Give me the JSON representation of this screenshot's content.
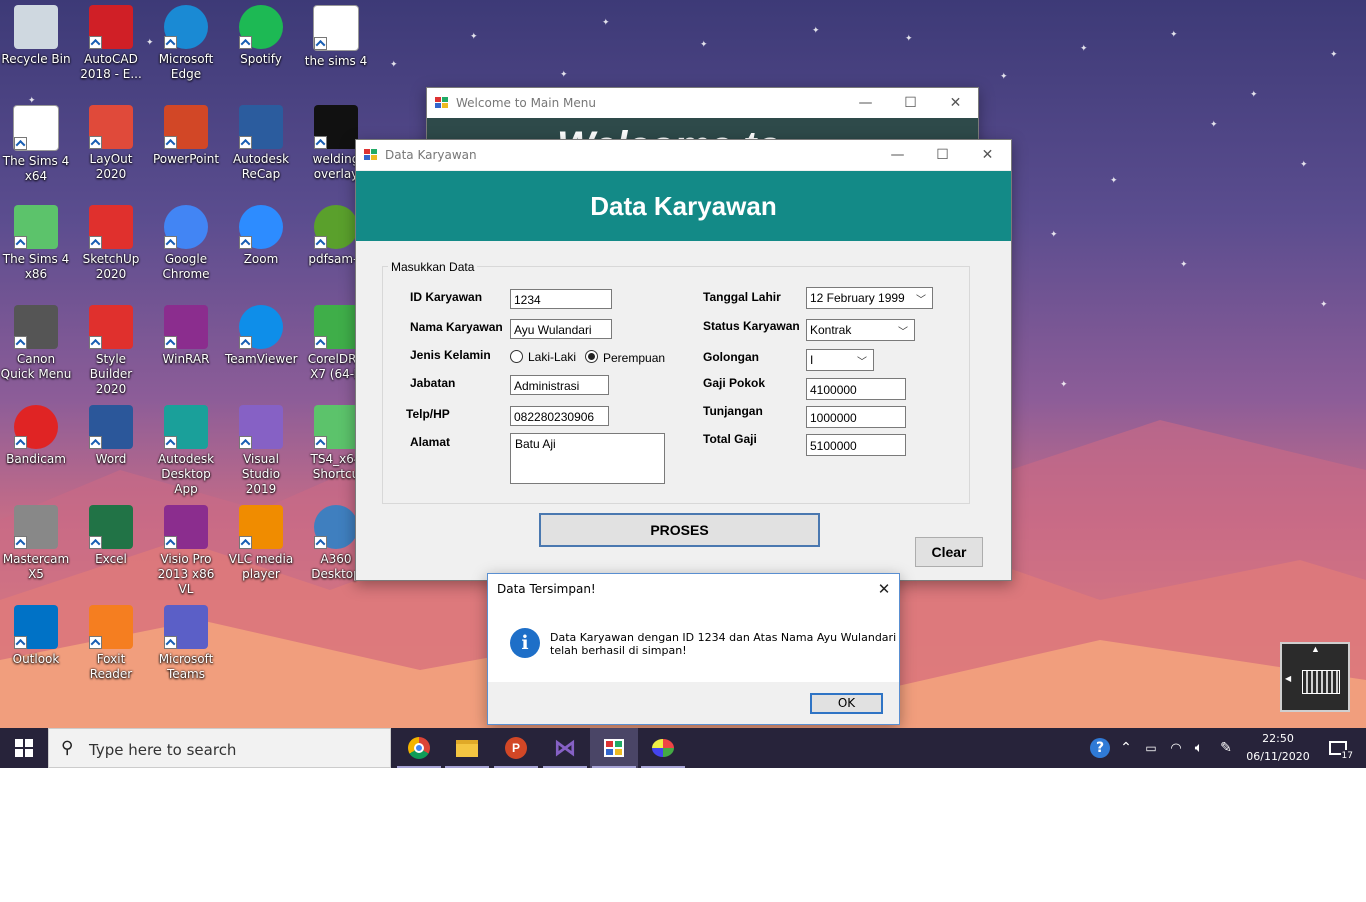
{
  "desktop": {
    "icons": [
      {
        "label": "Recycle Bin",
        "icon": "recycle-bin-icon"
      },
      {
        "label": "AutoCAD 2018 - E...",
        "icon": "autocad-icon"
      },
      {
        "label": "Microsoft Edge",
        "icon": "edge-icon"
      },
      {
        "label": "Spotify",
        "icon": "spotify-icon"
      },
      {
        "label": "the sims 4",
        "icon": "text-file-icon"
      },
      {
        "label": "The Sims 4 x64",
        "icon": "file-icon"
      },
      {
        "label": "LayOut 2020",
        "icon": "layout-icon"
      },
      {
        "label": "PowerPoint",
        "icon": "powerpoint-icon"
      },
      {
        "label": "Autodesk ReCap",
        "icon": "recap-icon"
      },
      {
        "label": "welding overlay",
        "icon": "welding-icon"
      },
      {
        "label": "The Sims 4 x86",
        "icon": "sims-icon"
      },
      {
        "label": "SketchUp 2020",
        "icon": "sketchup-icon"
      },
      {
        "label": "Google Chrome",
        "icon": "chrome-icon"
      },
      {
        "label": "Zoom",
        "icon": "zoom-icon"
      },
      {
        "label": "pdfsam-s",
        "icon": "pdfsam-icon"
      },
      {
        "label": "Canon Quick Menu",
        "icon": "canon-icon"
      },
      {
        "label": "Style Builder 2020",
        "icon": "style-builder-icon"
      },
      {
        "label": "WinRAR",
        "icon": "winrar-icon"
      },
      {
        "label": "TeamViewer",
        "icon": "teamviewer-icon"
      },
      {
        "label": "CorelDRA X7 (64-B",
        "icon": "coreldraw-icon"
      },
      {
        "label": "Bandicam",
        "icon": "bandicam-icon"
      },
      {
        "label": "Word",
        "icon": "word-icon"
      },
      {
        "label": "Autodesk Desktop App",
        "icon": "autodesk-app-icon"
      },
      {
        "label": "Visual Studio 2019",
        "icon": "visual-studio-icon"
      },
      {
        "label": "TS4_x64 Shortcu",
        "icon": "sims-icon"
      },
      {
        "label": "Mastercam X5",
        "icon": "mastercam-icon"
      },
      {
        "label": "Excel",
        "icon": "excel-icon"
      },
      {
        "label": "Visio Pro 2013 x86 VL",
        "icon": "winrar-icon"
      },
      {
        "label": "VLC media player",
        "icon": "vlc-icon"
      },
      {
        "label": "A360 Desktop",
        "icon": "a360-icon"
      },
      {
        "label": "Outlook",
        "icon": "outlook-icon"
      },
      {
        "label": "Foxit Reader",
        "icon": "foxit-icon"
      },
      {
        "label": "Microsoft Teams",
        "icon": "teams-icon"
      }
    ]
  },
  "main_menu_window": {
    "title": "Welcome to Main Menu",
    "banner_partial": "Welcome to"
  },
  "data_window": {
    "title": "Data Karyawan",
    "header": "Data Karyawan",
    "group_title": "Masukkan Data",
    "labels": {
      "id": "ID Karyawan",
      "nama": "Nama Karyawan",
      "jenis_kelamin": "Jenis Kelamin",
      "jabatan": "Jabatan",
      "telp": "Telp/HP",
      "alamat": "Alamat",
      "tanggal_lahir": "Tanggal Lahir",
      "status": "Status Karyawan",
      "golongan": "Golongan",
      "gaji_pokok": "Gaji Pokok",
      "tunjangan": "Tunjangan",
      "total_gaji": "Total Gaji"
    },
    "values": {
      "id": "1234",
      "nama": "Ayu Wulandari",
      "jabatan": "Administrasi",
      "telp": "082280230906",
      "alamat": "Batu Aji",
      "tanggal_lahir": "12  February  1999",
      "status": "Kontrak",
      "golongan": "I",
      "gaji_pokok": "4100000",
      "tunjangan": "1000000",
      "total_gaji": "5100000"
    },
    "gender_options": [
      "Laki-Laki",
      "Perempuan"
    ],
    "gender_selected": "Perempuan",
    "proses_label": "PROSES",
    "clear_label": "Clear",
    "colors": {
      "header_bg": "#138a87",
      "header_text": "#ffffff"
    }
  },
  "dialog": {
    "title": "Data Tersimpan!",
    "message_line1": "Data Karyawan dengan ID 1234 dan Atas Nama Ayu Wulandari",
    "message_line2": "telah berhasil di simpan!",
    "ok_label": "OK",
    "icon": "info-icon"
  },
  "taskbar": {
    "search_placeholder": "Type here to search",
    "time": "22:50",
    "date": "06/11/2020",
    "notification_count": "17",
    "apps": [
      "chrome-icon",
      "file-explorer-icon",
      "powerpoint-icon",
      "visual-studio-icon",
      "winforms-app-icon",
      "paint-icon"
    ]
  }
}
